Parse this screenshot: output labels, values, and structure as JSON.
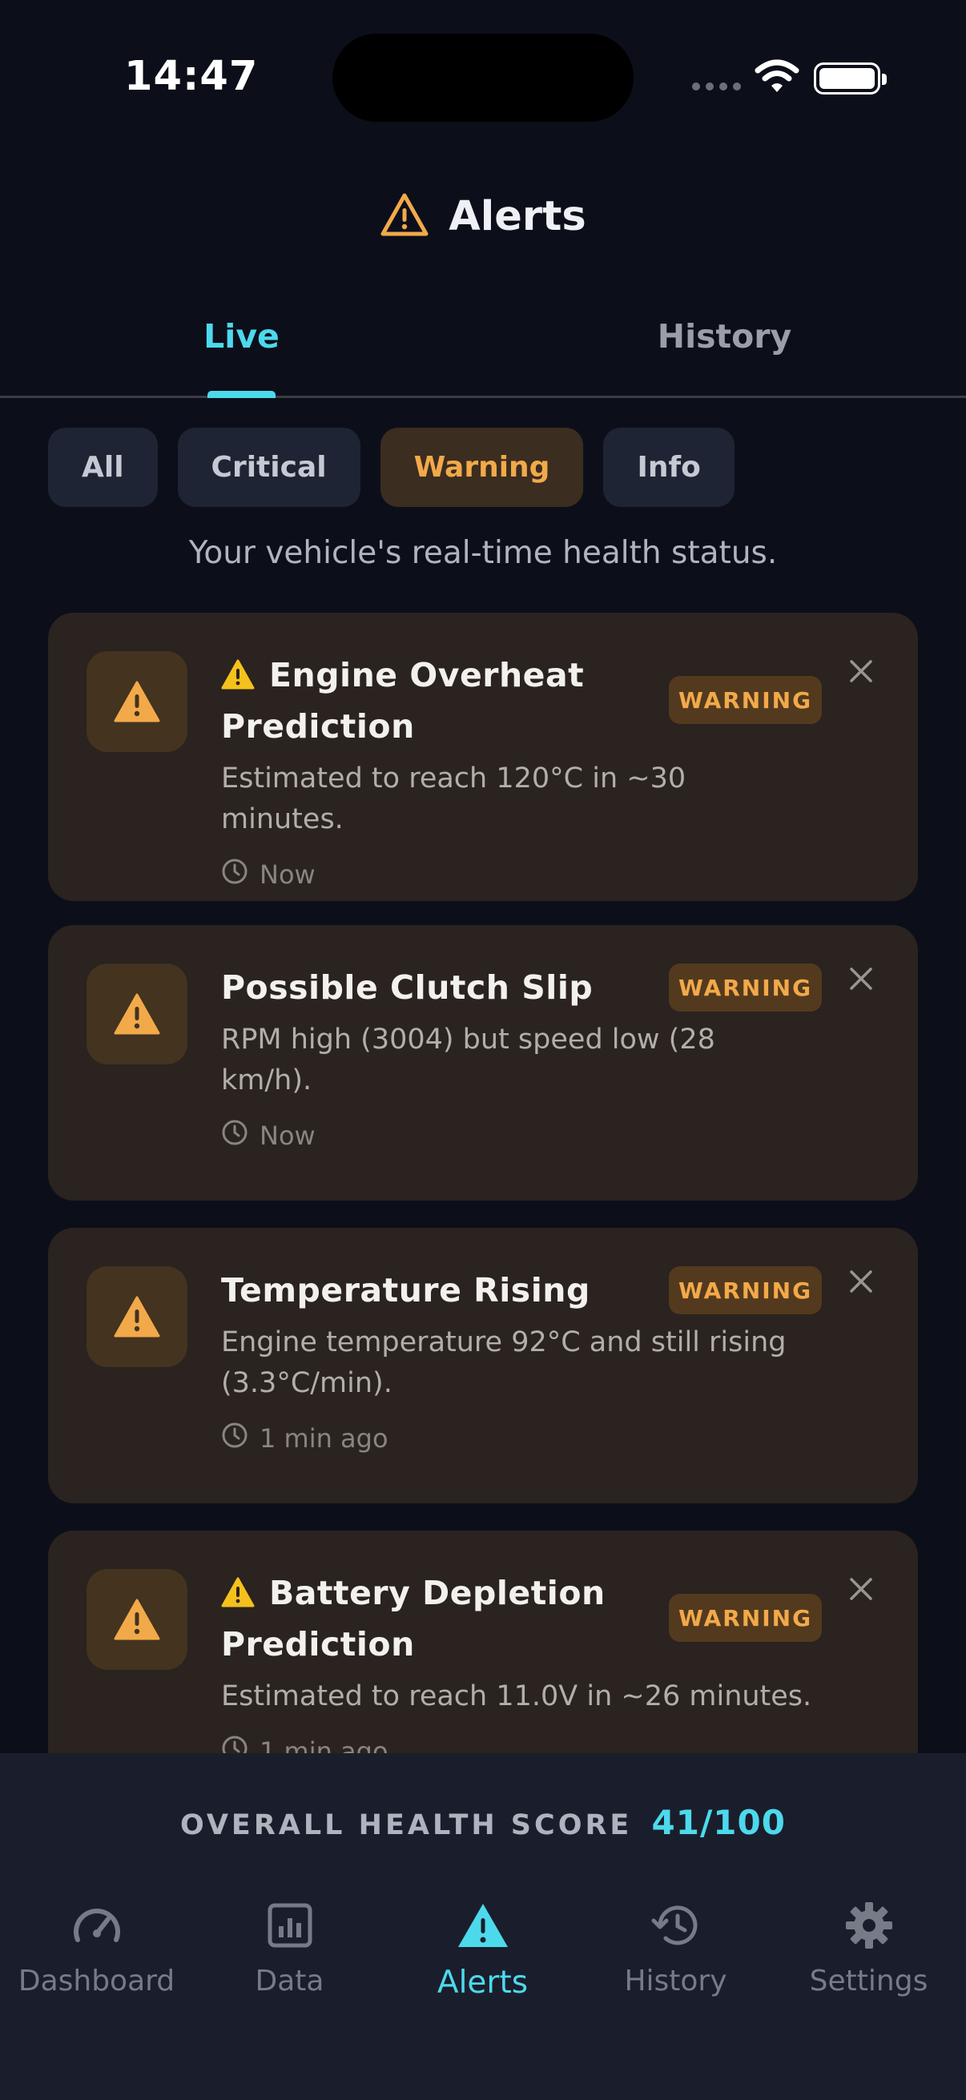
{
  "status_bar": {
    "time": "14:47"
  },
  "header": {
    "title": "Alerts",
    "icon": "warning-triangle-icon"
  },
  "tabs": [
    {
      "label": "Live",
      "active": true
    },
    {
      "label": "History",
      "active": false
    }
  ],
  "filters": [
    {
      "label": "All",
      "active": false
    },
    {
      "label": "Critical",
      "active": false
    },
    {
      "label": "Warning",
      "active": true
    },
    {
      "label": "Info",
      "active": false
    }
  ],
  "subtitle": "Your vehicle's real-time health status.",
  "alerts": [
    {
      "title": "Engine Overheat Prediction",
      "prediction": true,
      "badge": "WARNING",
      "description": "Estimated to reach 120°C in ~30 minutes.",
      "time": "Now"
    },
    {
      "title": "Possible Clutch Slip",
      "prediction": false,
      "badge": "WARNING",
      "description": "RPM high (3004) but speed low (28 km/h).",
      "time": "Now"
    },
    {
      "title": "Temperature Rising",
      "prediction": false,
      "badge": "WARNING",
      "description": "Engine temperature 92°C and still rising (3.3°C/min).",
      "time": "1 min ago"
    },
    {
      "title": "Battery Depletion Prediction",
      "prediction": true,
      "badge": "WARNING",
      "description": "Estimated to reach 11.0V in ~26 minutes.",
      "time": "1 min ago"
    }
  ],
  "health": {
    "label": "OVERALL HEALTH SCORE",
    "value": "41/100"
  },
  "nav": [
    {
      "label": "Dashboard",
      "icon": "speedometer-icon",
      "active": false
    },
    {
      "label": "Data",
      "icon": "bar-chart-icon",
      "active": false
    },
    {
      "label": "Alerts",
      "icon": "warning-triangle-icon",
      "active": true
    },
    {
      "label": "History",
      "icon": "history-icon",
      "active": false
    },
    {
      "label": "Settings",
      "icon": "gear-icon",
      "active": false
    }
  ],
  "colors": {
    "background": "#0c0f1a",
    "accent": "#4dd9ec",
    "warning": "#f2a94a",
    "card": "#2a231f"
  }
}
